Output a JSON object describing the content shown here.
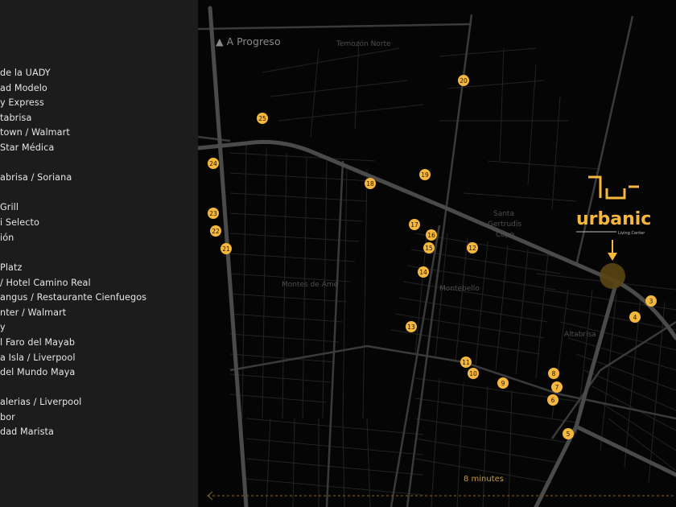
{
  "legend": [
    "de la UADY",
    "ad Modelo",
    "y Express",
    "tabrisa",
    "town / Walmart",
    "Star Médica",
    "",
    "abrisa / Soriana",
    "",
    "Grill",
    "i Selecto",
    "ión",
    "",
    "Platz",
    "/ Hotel Camino Real",
    "angus / Restaurante Cienfuegos",
    "nter / Walmart",
    "y",
    "l Faro del Mayab",
    "a Isla / Liverpool",
    "del Mundo Maya",
    "",
    "alerias / Liverpool",
    "bor",
    "dad Marista"
  ],
  "map": {
    "direction_label": "▲ A Progreso",
    "neighborhoods": [
      "Temozón Norte",
      "Santa Gertrudis Copo",
      "Montes de Ame",
      "Montebello",
      "Altabrisa"
    ],
    "brand": {
      "name": "urbanic",
      "tagline": "Living Center"
    },
    "travel_time": "8 minutes",
    "markers": [
      "3",
      "4",
      "5",
      "6",
      "7",
      "8",
      "9",
      "10",
      "11",
      "12",
      "13",
      "14",
      "15",
      "16",
      "17",
      "18",
      "19",
      "20",
      "21",
      "22",
      "23",
      "24",
      "25"
    ],
    "colors": {
      "marker": "#f5b83d",
      "road": "#4a4a4a",
      "street": "#2a2a2a",
      "background": "#050505",
      "sidebar": "#1c1c1c"
    }
  }
}
